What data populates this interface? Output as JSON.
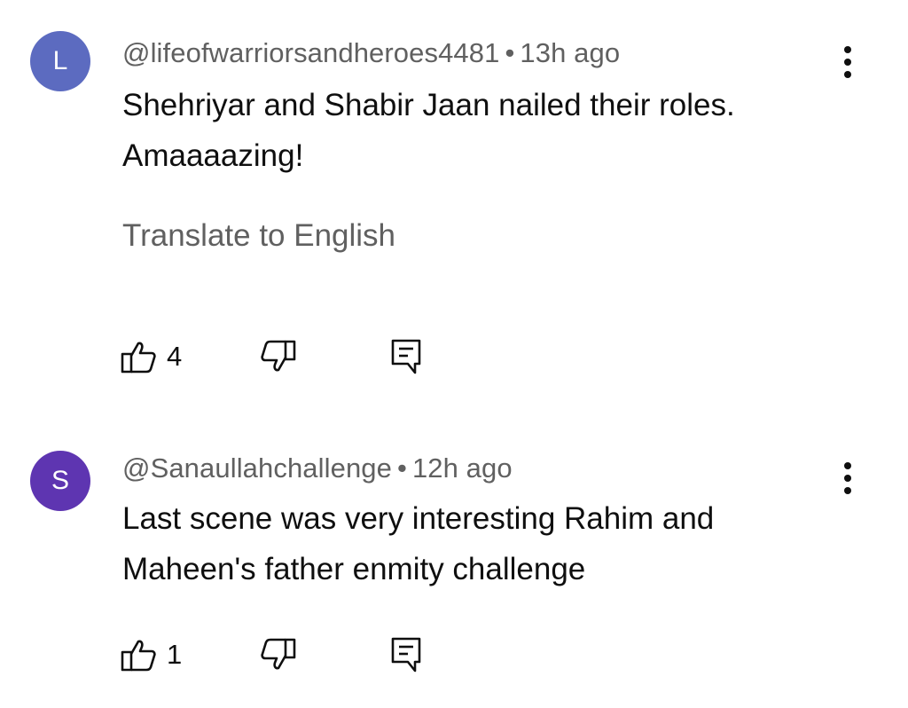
{
  "comments": [
    {
      "avatar_letter": "L",
      "avatar_color": "#5c6bc0",
      "author": "@lifeofwarriorsandheroes4481",
      "separator": "•",
      "time": "13h ago",
      "text": "Shehriyar and Shabir Jaan nailed their roles. Amaaaazing!",
      "translate_label": "Translate to English",
      "likes": "4",
      "icons": [
        "thumbs-up-icon",
        "thumbs-down-icon",
        "reply-icon",
        "more-vert-icon"
      ]
    },
    {
      "avatar_letter": "S",
      "avatar_color": "#5e35b1",
      "author": "@Sanaullahchallenge",
      "separator": "•",
      "time": "12h ago",
      "text": "Last scene was very interesting Rahim and Maheen's father enmity challenge",
      "likes": "1",
      "icons": [
        "thumbs-up-icon",
        "thumbs-down-icon",
        "reply-icon",
        "more-vert-icon"
      ]
    }
  ]
}
